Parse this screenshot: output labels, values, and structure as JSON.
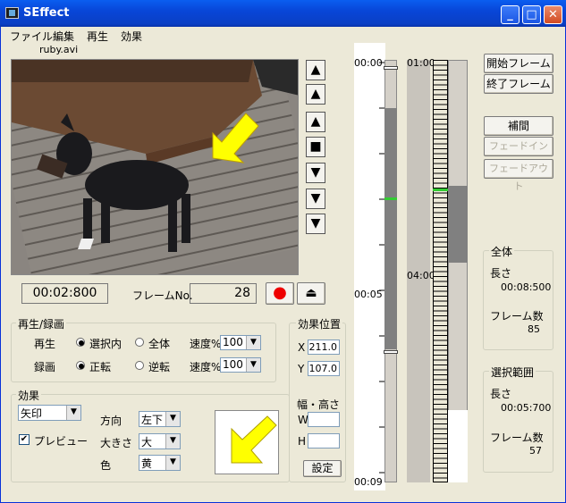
{
  "window": {
    "title": "SEffect"
  },
  "menu": [
    "ファイル",
    "編集",
    "再生",
    "効果"
  ],
  "file": {
    "name": "ruby.avi"
  },
  "transport": {
    "buttons": [
      "▲",
      "▲",
      "▲",
      "■",
      "▼",
      "▼",
      "▼"
    ],
    "record": "●",
    "eject": "⏏"
  },
  "status": {
    "time": "00:02:800",
    "frame_label": "フレームNo.",
    "frame_value": "28"
  },
  "playback": {
    "title": "再生/録画",
    "play_label": "再生",
    "play_opt1": "選択内",
    "play_opt2": "全体",
    "speed_label": "速度%",
    "play_speed": "100",
    "rec_label": "録画",
    "rec_opt1": "正転",
    "rec_opt2": "逆転",
    "rec_speed": "100"
  },
  "effect": {
    "title": "効果",
    "type": "矢印",
    "preview_label": "プレビュー",
    "dir_label": "方向",
    "dir_value": "左下",
    "size_label": "大きさ",
    "size_value": "大",
    "color_label": "色",
    "color_value": "黄",
    "arrow_color": "#ffff00"
  },
  "position": {
    "title": "効果位置",
    "x_label": "X",
    "x_value": "211.0",
    "y_label": "Y",
    "y_value": "107.0",
    "size_title": "幅・高さ",
    "w_label": "W",
    "w_value": "",
    "h_label": "H",
    "h_value": "",
    "set_label": "設定"
  },
  "timeline": {
    "start_time": "00:00",
    "mid_time": "00:05",
    "end_time": "00:09",
    "t1": "01:00",
    "t2": "04:00"
  },
  "side": {
    "start_frame": "開始フレーム",
    "end_frame": "終了フレーム",
    "interp": "補間",
    "fade_in": "フェードイン",
    "fade_out": "フェードアウト"
  },
  "summary": {
    "all_title": "全体",
    "length_label": "長さ",
    "all_length": "00:08:500",
    "frames_label": "フレーム数",
    "all_frames": "85",
    "sel_title": "選択範囲",
    "sel_length": "00:05:700",
    "sel_frames": "57"
  }
}
